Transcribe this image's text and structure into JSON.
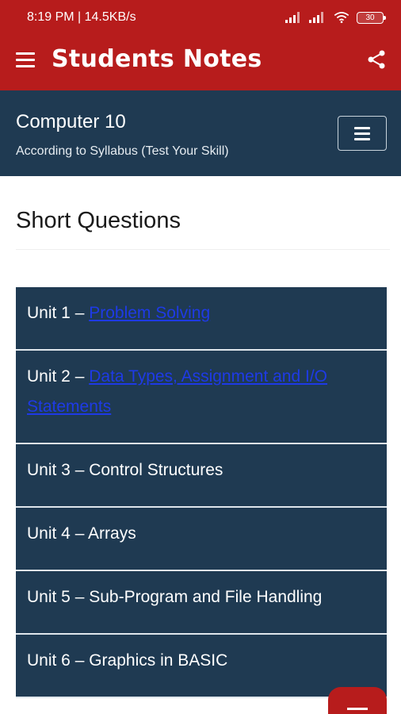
{
  "status_bar": {
    "time_speed": "8:19 PM | 14.5KB/s",
    "battery": "30"
  },
  "app_bar": {
    "title": "Students Notes"
  },
  "header": {
    "course_title": "Computer 10",
    "course_subtitle": "According to Syllabus (Test Your Skill)"
  },
  "section": {
    "title": "Short Questions"
  },
  "units": [
    {
      "prefix": "Unit 1 – ",
      "link": "Problem Solving",
      "text": ""
    },
    {
      "prefix": "Unit 2 – ",
      "link": "Data Types, Assignment and I/O Statements",
      "text": ""
    },
    {
      "prefix": "",
      "link": "",
      "text": "Unit 3 – Control Structures"
    },
    {
      "prefix": "",
      "link": "",
      "text": "Unit 4 – Arrays"
    },
    {
      "prefix": "",
      "link": "",
      "text": "Unit 5 – Sub-Program and File Handling"
    },
    {
      "prefix": "",
      "link": "",
      "text": "Unit 6 – Graphics in BASIC"
    }
  ],
  "colors": {
    "primary_red": "#b71c1c",
    "navy": "#1f3a52",
    "link_blue": "#1e3ae6"
  }
}
